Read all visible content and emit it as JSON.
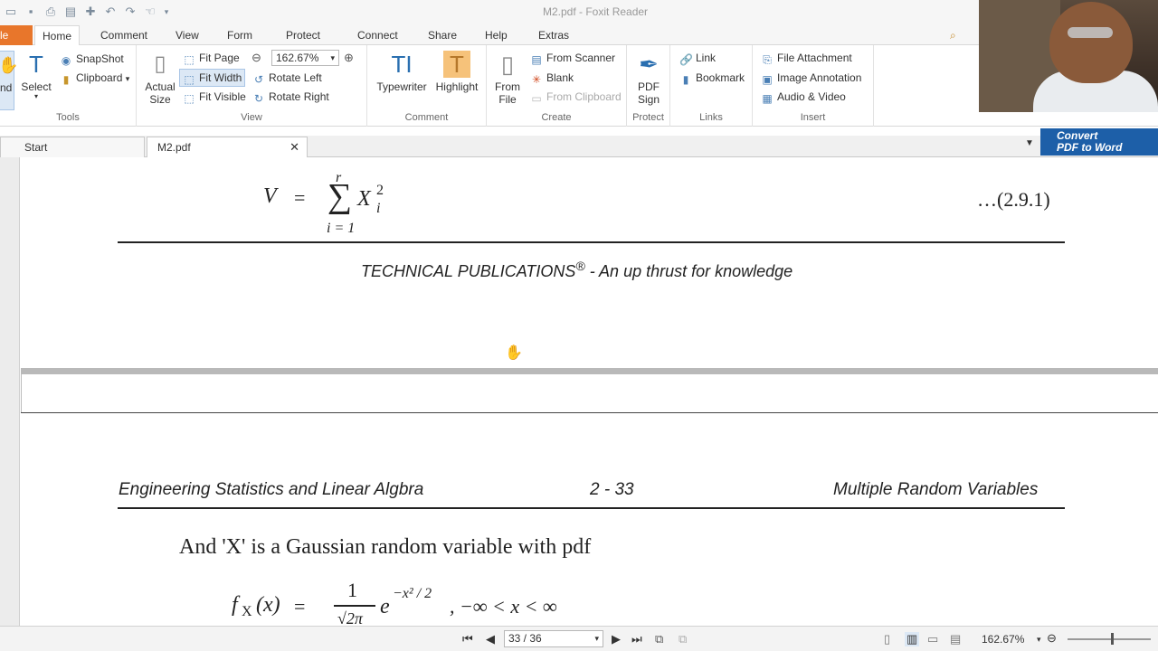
{
  "window": {
    "title": "M2.pdf - Foxit Reader"
  },
  "menu": {
    "file": "File",
    "tabs": [
      "Home",
      "Comment",
      "View",
      "Form",
      "Protect",
      "Connect",
      "Share",
      "Help",
      "Extras"
    ]
  },
  "ribbon": {
    "tools": {
      "hand": "Hand",
      "select": "Select",
      "snapshot": "SnapShot",
      "clipboard": "Clipboard",
      "label": "Tools"
    },
    "view": {
      "actual_size": [
        "Actual",
        "Size"
      ],
      "fit_page": "Fit Page",
      "fit_width": "Fit Width",
      "fit_visible": "Fit Visible",
      "zoom": "162.67%",
      "rotate_left": "Rotate Left",
      "rotate_right": "Rotate Right",
      "label": "View"
    },
    "comment": {
      "typewriter": "Typewriter",
      "highlight": "Highlight",
      "label": "Comment"
    },
    "create": {
      "from_file": [
        "From",
        "File"
      ],
      "from_scanner": "From Scanner",
      "blank": "Blank",
      "from_clipboard": "From Clipboard",
      "label": "Create"
    },
    "protect": {
      "pdf_sign": [
        "PDF",
        "Sign"
      ],
      "label": "Protect"
    },
    "links": {
      "link": "Link",
      "bookmark": "Bookmark",
      "label": "Links"
    },
    "insert": {
      "file_attachment": "File Attachment",
      "image_annotation": "Image Annotation",
      "audio_video": "Audio & Video",
      "label": "Insert"
    }
  },
  "doc_tabs": [
    "Start",
    "M2.pdf"
  ],
  "convert": [
    "Convert",
    "PDF to Word"
  ],
  "document": {
    "eq1": {
      "lhs": "V",
      "equals": "=",
      "sum_top": "r",
      "sum_bottom": "i = 1",
      "term": "X",
      "sub": "i",
      "sup": "2",
      "number": "…(2.9.1)"
    },
    "footer": {
      "text": "TECHNICAL PUBLICATIONS",
      "reg": "®",
      "tagline": " - An up thrust for knowledge"
    },
    "header": {
      "left": "Engineering Statistics and Linear Algbra",
      "center": "2 - 33",
      "right": "Multiple Random Variables"
    },
    "body_line": "And 'X' is a Gaussian random variable with pdf",
    "eq2": {
      "f": "f",
      "sub": "X",
      "arg": "(x)",
      "equals": "=",
      "numerator": "1",
      "denominator": "√2π",
      "exp_base": "e",
      "exp": "−x² / 2",
      "range": ", −∞ < x < ∞"
    }
  },
  "statusbar": {
    "page": "33 / 36",
    "zoom": "162.67%"
  }
}
